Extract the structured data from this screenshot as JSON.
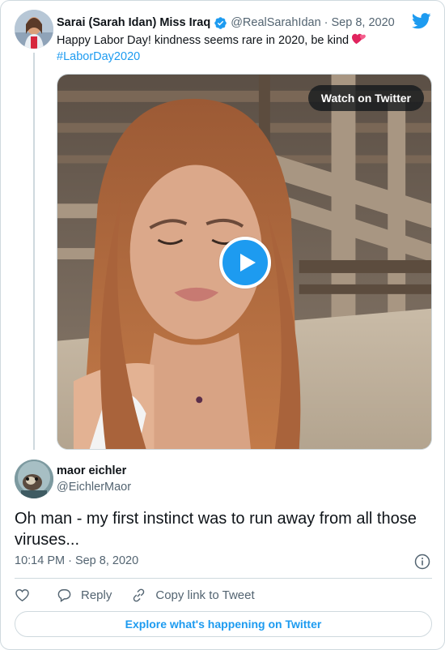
{
  "top_tweet": {
    "display_name": "Sarai (Sarah Idan) Miss Iraq",
    "handle": "@RealSarahIdan",
    "separator": "·",
    "date": "Sep 8, 2020",
    "text": "Happy Labor Day! kindness seems rare in 2020, be kind ",
    "hashtag": "#LaborDay2020",
    "media": {
      "watch_label": "Watch on Twitter"
    }
  },
  "reply_tweet": {
    "display_name": "maor eichler",
    "handle": "@EichlerMaor",
    "text": "Oh man - my first instinct was to run away from all those viruses...",
    "timestamp": "10:14 PM · Sep 8, 2020"
  },
  "actions": {
    "reply_label": "Reply",
    "copy_link_label": "Copy link to Tweet"
  },
  "footer": {
    "explore_label": "Explore what's happening on Twitter"
  },
  "colors": {
    "accent": "#1d9bf0",
    "text": "#0f1419",
    "muted": "#536471",
    "border": "#cfd9de"
  }
}
